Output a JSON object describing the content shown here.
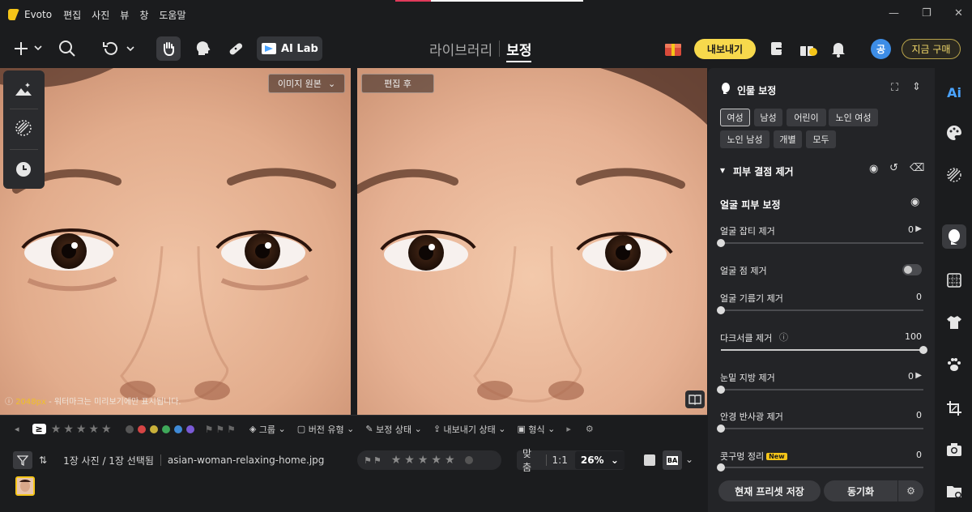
{
  "titlebar": {
    "app_name": "Evoto",
    "menu": [
      "편집",
      "사진",
      "뷰",
      "창",
      "도움말"
    ],
    "controls": [
      "minimize",
      "restore",
      "close"
    ]
  },
  "toolbar": {
    "ai_lab": "AI Lab",
    "mode_library": "라이브러리",
    "mode_retouch": "보정",
    "export": "내보내기",
    "avatar": "공",
    "buy": "지금 구매"
  },
  "canvas": {
    "before_label": "이미지 원본",
    "after_label": "편집 후",
    "watermark_size": "2048px",
    "watermark_text": " - 워터마크는 미리보기에만 표시됩니다."
  },
  "filterbar": {
    "rating_op": "≥",
    "color_dots": [
      "#555555",
      "#d64545",
      "#c9b03a",
      "#3fa85a",
      "#3f8ad6",
      "#7a5ad6"
    ],
    "group": "그룹",
    "version_type": "버전 유형",
    "edit_status": "보정 상태",
    "export_status": "내보내기 상태",
    "format": "형식"
  },
  "bottombar": {
    "count_text": "1장 사진 / 1장 선택됨",
    "filename": "asian-woman-relaxing-home.jpg",
    "fit": "맞춤",
    "one_to_one": "1:1",
    "zoom": "26%",
    "ba": "BA"
  },
  "panel": {
    "title": "인물 보정",
    "chips": [
      "여성",
      "남성",
      "어린이",
      "노인 여성",
      "노인 남성",
      "개별",
      "모두"
    ],
    "selected_chip": "여성",
    "section": "피부 결점 제거",
    "subsection": "얼굴 피부 보정",
    "rows": [
      {
        "label": "얼굴 잡티 제거",
        "value": "0",
        "level": 0,
        "arrow": true
      },
      {
        "label": "얼굴 점 제거",
        "toggle": false
      },
      {
        "label": "얼굴 기름기 제거",
        "value": "0",
        "level": 0
      },
      {
        "label": "다크서클 제거",
        "value": "100",
        "level": 1.0,
        "help": true
      },
      {
        "label": "눈밑 지방 제거",
        "value": "0",
        "level": 0,
        "arrow": true
      },
      {
        "label": "안경 반사광 제거",
        "value": "0",
        "level": 0
      },
      {
        "label": "콧구멍 정리",
        "value": "0",
        "level": 0,
        "new": "New"
      }
    ],
    "save_preset": "현재 프리셋 저장",
    "sync": "동기화"
  },
  "rail": {
    "icons": [
      "ai-icon",
      "palette-icon",
      "texture-icon",
      "face-icon",
      "grid-icon",
      "shirt-icon",
      "paw-icon",
      "crop-icon",
      "camera-icon",
      "folder-icon"
    ],
    "ai_text": "Ai"
  }
}
